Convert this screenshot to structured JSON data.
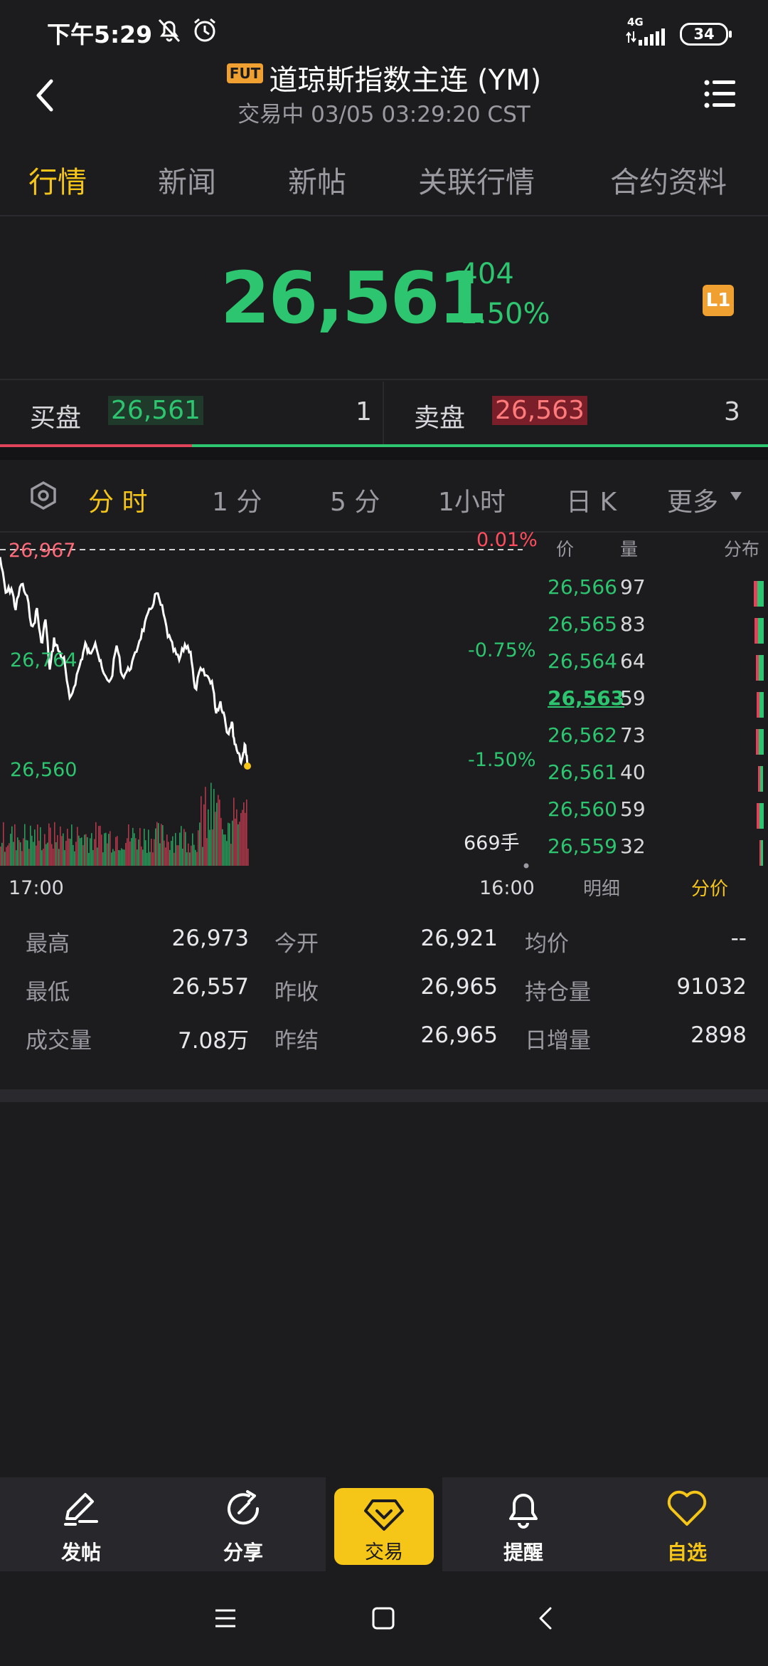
{
  "status_bar": {
    "time": "下午5:29",
    "network": "4G",
    "battery": "34"
  },
  "header": {
    "badge": "FUT",
    "title": "道琼斯指数主连 (YM)",
    "subtitle": "交易中 03/05 03:29:20 CST"
  },
  "tabs": [
    {
      "label": "行情",
      "active": true
    },
    {
      "label": "新闻",
      "active": false
    },
    {
      "label": "新帖",
      "active": false
    },
    {
      "label": "关联行情",
      "active": false
    },
    {
      "label": "合约资料",
      "active": false
    }
  ],
  "quote": {
    "price": "26,561",
    "change": "-404",
    "change_pct": "-1.50%",
    "level_badge": "L1"
  },
  "bid": {
    "label": "买盘",
    "price": "26,561",
    "qty": "1"
  },
  "ask": {
    "label": "卖盘",
    "price": "26,563",
    "qty": "3"
  },
  "periods": [
    {
      "label": "分 时",
      "active": true
    },
    {
      "label": "1 分",
      "active": false
    },
    {
      "label": "5 分",
      "active": false
    },
    {
      "label": "1小时",
      "active": false
    },
    {
      "label": "日 K",
      "active": false
    },
    {
      "label": "更多",
      "active": false
    }
  ],
  "chart": {
    "price_high": "26,967",
    "price_mid": "26,764",
    "price_low": "26,560",
    "pct_high": "0.01%",
    "pct_mid": "-0.75%",
    "pct_low": "-1.50%",
    "volume_label": "669手",
    "time_start": "17:00",
    "time_end": "16:00",
    "colors": {
      "up": "#e0435a",
      "down": "#2dc56f",
      "line": "#ffffff",
      "dot": "#f5c518"
    }
  },
  "order_book": {
    "header_price": "价",
    "header_volume": "量",
    "header_distribution": "分布",
    "rows": [
      {
        "price": "26,566",
        "volume": "97"
      },
      {
        "price": "26,565",
        "volume": "83"
      },
      {
        "price": "26,564",
        "volume": "64"
      },
      {
        "price": "26,563",
        "volume": "59"
      },
      {
        "price": "26,562",
        "volume": "73"
      },
      {
        "price": "26,561",
        "volume": "40"
      },
      {
        "price": "26,560",
        "volume": "59"
      },
      {
        "price": "26,559",
        "volume": "32"
      }
    ],
    "footer_detail": "明细",
    "footer_split": "分价"
  },
  "stats": [
    {
      "label": "最高",
      "value": "26,973"
    },
    {
      "label": "今开",
      "value": "26,921"
    },
    {
      "label": "均价",
      "value": "--"
    },
    {
      "label": "最低",
      "value": "26,557"
    },
    {
      "label": "昨收",
      "value": "26,965"
    },
    {
      "label": "持仓量",
      "value": "91032"
    },
    {
      "label": "成交量",
      "value": "7.08万"
    },
    {
      "label": "昨结",
      "value": "26,965"
    },
    {
      "label": "日增量",
      "value": "2898"
    }
  ],
  "bottom_nav": [
    {
      "label": "发帖",
      "icon": "edit-icon"
    },
    {
      "label": "分享",
      "icon": "share-icon"
    },
    {
      "label": "交易",
      "icon": "trade-icon"
    },
    {
      "label": "提醒",
      "icon": "bell-icon"
    },
    {
      "label": "自选",
      "icon": "heart-icon"
    }
  ]
}
